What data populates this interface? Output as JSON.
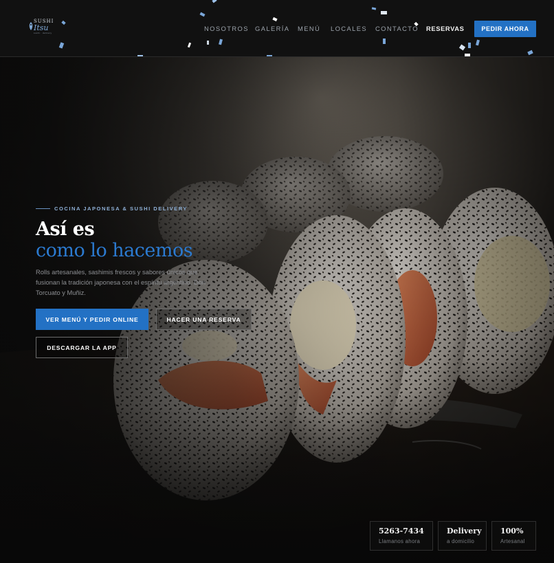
{
  "brand": {
    "name": "Sushi Itsu",
    "line1": "SUSHI",
    "line2": "Itsu",
    "tagline": "sushi · delivery"
  },
  "nav": {
    "items": [
      {
        "label": "NOSOTROS"
      },
      {
        "label": "GALERÍA"
      },
      {
        "label": "MENÚ"
      },
      {
        "label": "LOCALES"
      },
      {
        "label": "CONTACTO"
      },
      {
        "label": "RESERVAS"
      }
    ],
    "cta_label": "PEDIR AHORA"
  },
  "hero": {
    "eyebrow": "COCINA JAPONESA & SUSHI DELIVERY",
    "title": "Así es",
    "title_accent": "como lo hacemos",
    "description": "Rolls artesanales, sashimis frescos y sabores únicos que fusionan la tradición japonesa con el espíritu argentino. Don Torcuato y Muñiz.",
    "buttons": {
      "order": "VER MENÚ Y PEDIR ONLINE",
      "reserve": "HACER UNA RESERVA",
      "app": "DESCARGAR LA APP"
    }
  },
  "stats": [
    {
      "value": "5263-7434",
      "label": "Llamanos ahora"
    },
    {
      "value": "Delivery",
      "label": "a domicilio"
    },
    {
      "value": "100%",
      "label": "Artesanal"
    }
  ],
  "colors": {
    "accent": "#2371c4",
    "accent_text": "#2b7ad0",
    "header_bg": "#111111",
    "muted_text": "#8d8f93"
  },
  "icons": {
    "logo": "fish-icon",
    "decoration": "confetti-icon"
  }
}
